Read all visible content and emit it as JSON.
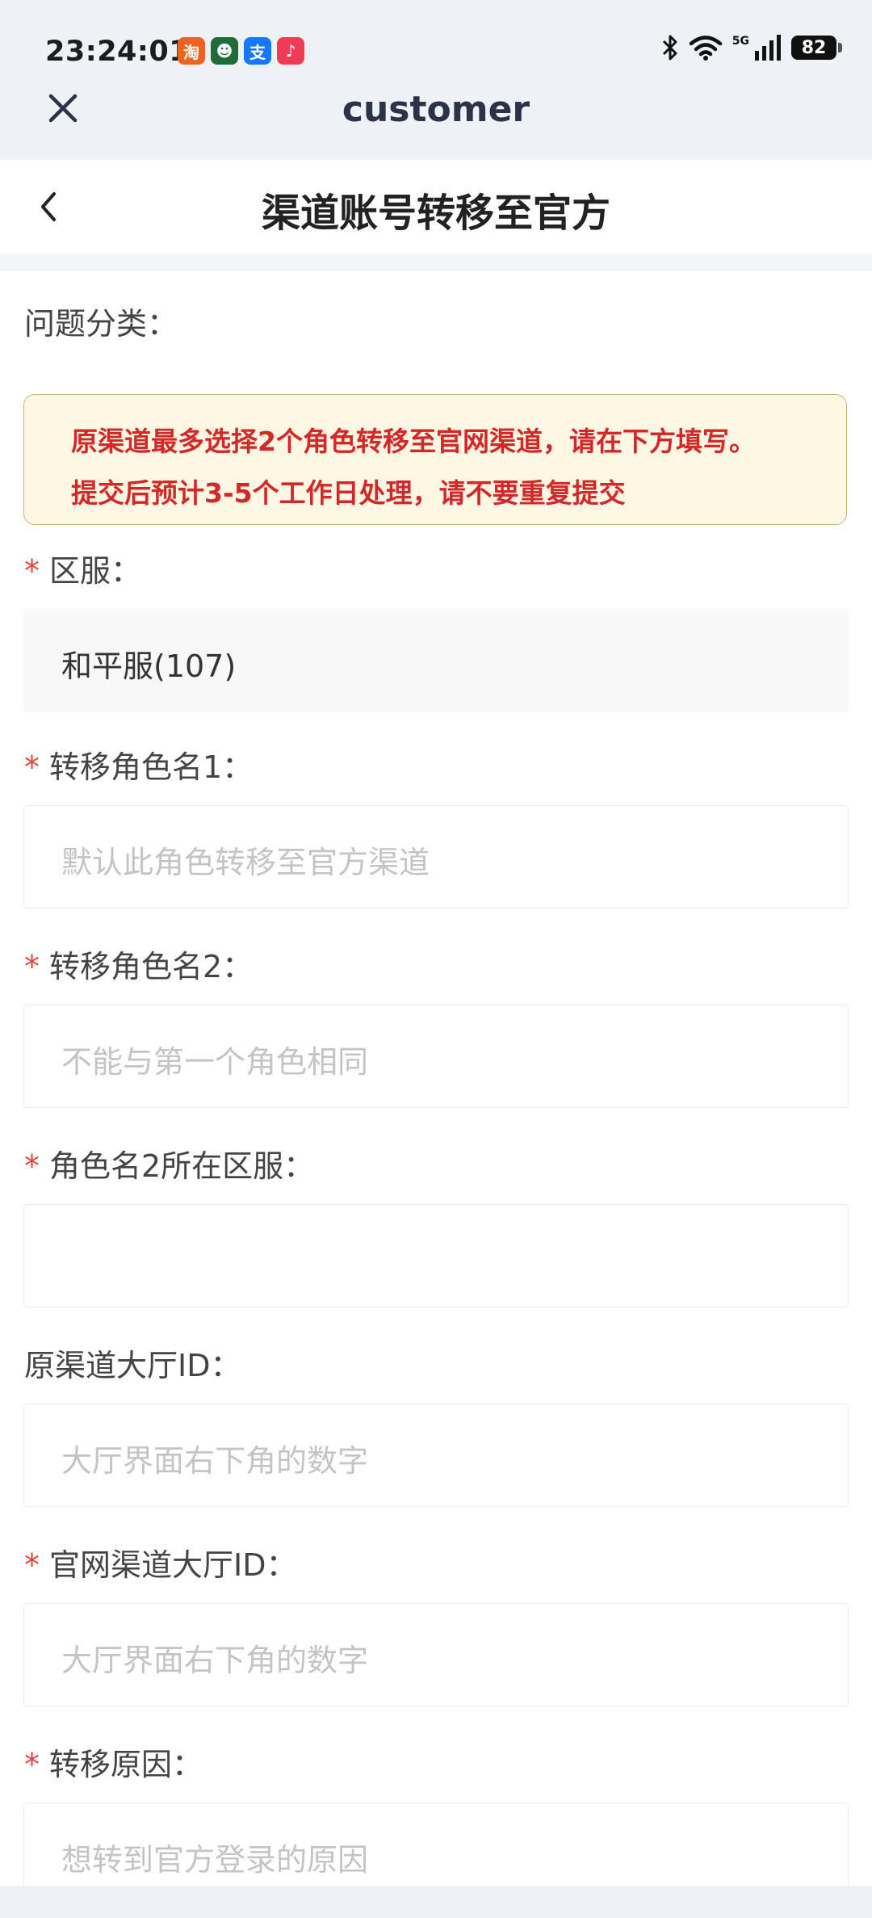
{
  "status_bar": {
    "time": "23:24:01",
    "app_icons": [
      {
        "name": "taobao-app-icon",
        "glyph": "淘",
        "color": "#f2621f"
      },
      {
        "name": "game-app-icon",
        "glyph": "☻",
        "color": "#1f6b3a"
      },
      {
        "name": "alipay-app-icon",
        "glyph": "支",
        "color": "#1677ff"
      },
      {
        "name": "music-app-icon",
        "glyph": "♪",
        "color": "#f03b57"
      }
    ],
    "network": "5G",
    "battery": "82"
  },
  "app_header": {
    "title": "customer"
  },
  "page": {
    "title": "渠道账号转移至官方"
  },
  "form": {
    "category_label": "问题分类：",
    "notice_lines": [
      "原渠道最多选择2个角色转移至官网渠道，请在下方填写。",
      "提交后预计3-5个工作日处理，请不要重复提交"
    ],
    "fields": [
      {
        "label": "区服：",
        "required": true,
        "value": "和平服(107)",
        "placeholder": ""
      },
      {
        "label": "转移角色名1：",
        "required": true,
        "value": "",
        "placeholder": "默认此角色转移至官方渠道"
      },
      {
        "label": "转移角色名2：",
        "required": true,
        "value": "",
        "placeholder": "不能与第一个角色相同"
      },
      {
        "label": "角色名2所在区服：",
        "required": true,
        "value": "",
        "placeholder": ""
      },
      {
        "label": "原渠道大厅ID：",
        "required": false,
        "value": "",
        "placeholder": "大厅界面右下角的数字"
      },
      {
        "label": "官网渠道大厅ID：",
        "required": true,
        "value": "",
        "placeholder": "大厅界面右下角的数字"
      },
      {
        "label": "转移原因：",
        "required": true,
        "value": "",
        "placeholder": "想转到官方登录的原因"
      }
    ]
  },
  "colors": {
    "required_star": "#e0463c",
    "notice_text": "#d42828",
    "notice_bg": "#fdf7e4",
    "header_bg": "#eef2f7"
  }
}
